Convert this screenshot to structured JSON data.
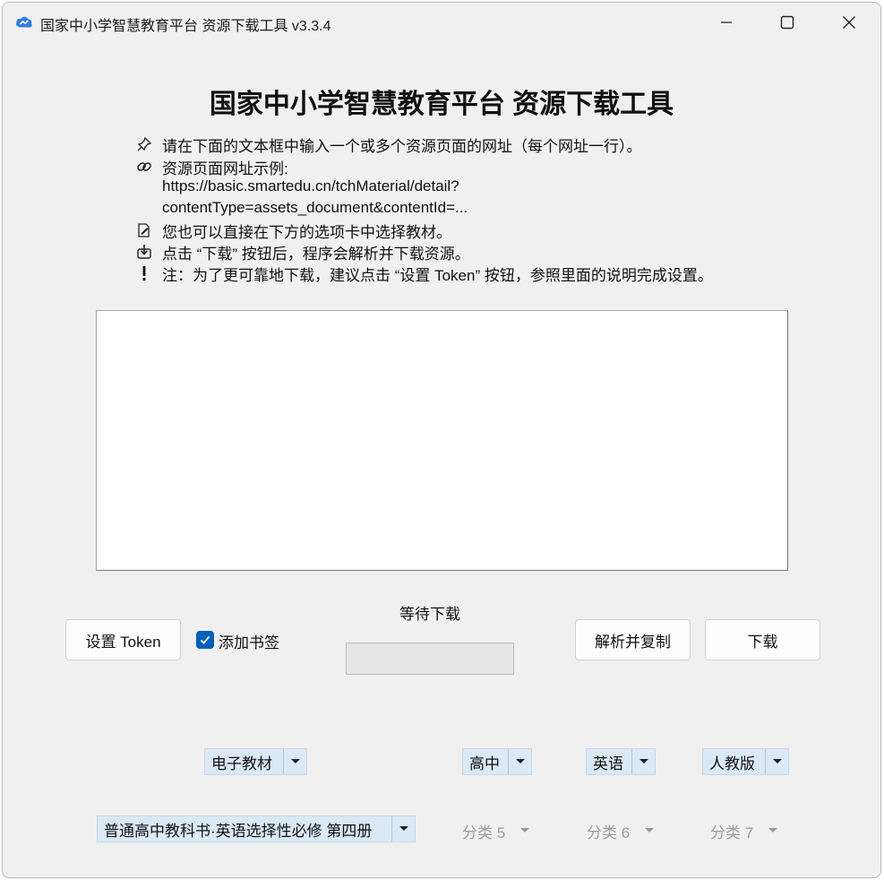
{
  "window": {
    "title": "国家中小学智慧教育平台 资源下载工具 v3.3.4"
  },
  "header": {
    "title": "国家中小学智慧教育平台 资源下载工具"
  },
  "instructions": {
    "line1": "请在下面的文本框中输入一个或多个资源页面的网址（每个网址一行）。",
    "line2": "资源页面网址示例:",
    "line2_url1": "https://basic.smartedu.cn/tchMaterial/detail?",
    "line2_url2": "contentType=assets_document&contentId=...",
    "line3": "您也可以直接在下方的选项卡中选择教材。",
    "line4": "点击 “下载” 按钮后，程序会解析并下载资源。",
    "line5": "注：为了更可靠地下载，建议点击 “设置 Token” 按钮，参照里面的说明完成设置。"
  },
  "url_input": {
    "value": ""
  },
  "controls": {
    "token_button": "设置 Token",
    "bookmark_label": "添加书签",
    "bookmark_checked": true,
    "status": "等待下载",
    "progress": 0,
    "parse_copy_button": "解析并复制",
    "download_button": "下载"
  },
  "filters": {
    "row1": [
      "电子教材",
      "高中",
      "英语",
      "人教版"
    ],
    "row2": [
      "普通高中教科书·英语选择性必修 第四册",
      "分类 5",
      "分类 6",
      "分类 7"
    ]
  },
  "colors": {
    "window_bg": "#f0f0f0",
    "accent": "#005fb8",
    "combo_bg": "#dbe8f5",
    "disabled_text": "#9a9a9a"
  }
}
